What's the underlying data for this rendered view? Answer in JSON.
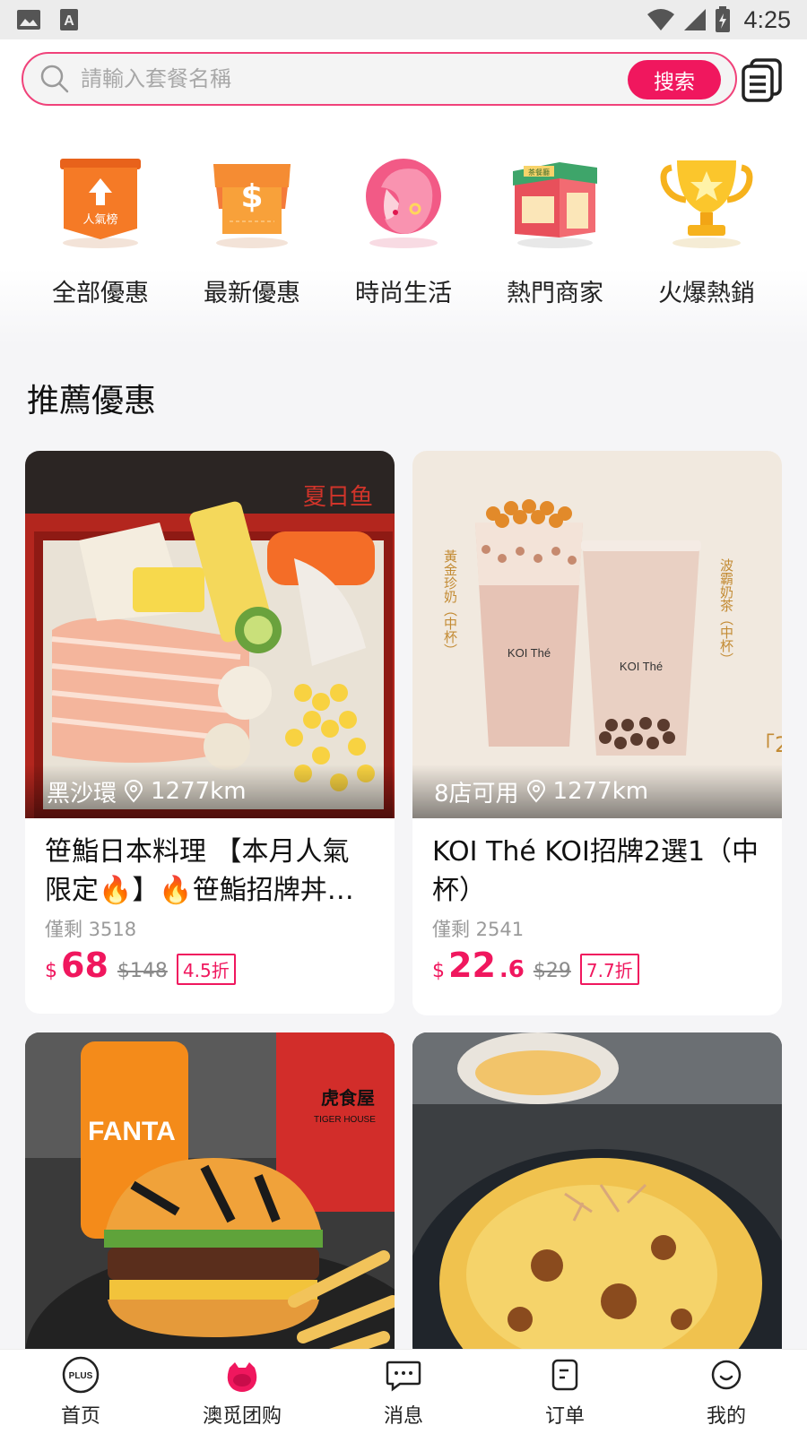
{
  "status_bar": {
    "time": "4:25",
    "icons": [
      "image-icon",
      "text-a-icon",
      "wifi-icon",
      "signal-icon",
      "battery-icon"
    ]
  },
  "search": {
    "placeholder": "請輸入套餐名稱",
    "button_label": "搜索"
  },
  "categories": [
    {
      "label": "全部優惠",
      "icon": "popularity-ranking-icon",
      "badge": "人氣榜"
    },
    {
      "label": "最新優惠",
      "icon": "coupon-dollar-icon"
    },
    {
      "label": "時尚生活",
      "icon": "fashion-woman-icon"
    },
    {
      "label": "熱門商家",
      "icon": "shop-icon",
      "badge": "茶餐廳"
    },
    {
      "label": "火爆熱銷",
      "icon": "trophy-icon"
    }
  ],
  "section": {
    "title": "推薦優惠"
  },
  "products": [
    {
      "location": "黑沙環",
      "distance": "1277km",
      "title": "笹鮨日本料理 【本月人氣限定🔥】🔥笹鮨招牌丼…",
      "remaining": "僅剩 3518",
      "currency": "$",
      "price_int": "68",
      "price_dec": "",
      "original_price": "$148",
      "discount": "4.5折",
      "image_text": "夏日鱼"
    },
    {
      "location": "8店可用",
      "distance": "1277km",
      "title": "KOI Thé KOI招牌2選1（中杯）",
      "remaining": "僅剩 2541",
      "currency": "$",
      "price_int": "22",
      "price_dec": ".6",
      "original_price": "$29",
      "discount": "7.7折",
      "image_text_left": "黃金珍奶（中杯）",
      "image_text_right": "波霸奶茶（中杯）",
      "cup_brand": "KOI Thé",
      "corner_text": "「2"
    },
    {
      "image": "tiger-burger-fries",
      "image_text": "FANTA",
      "box_text": "虎食屋",
      "box_sub": "TIGER HOUSE"
    },
    {
      "image": "okonomiyaki-plate"
    }
  ],
  "bottom_nav": [
    {
      "label": "首页",
      "icon": "plus-home-icon"
    },
    {
      "label": "澳觅团购",
      "icon": "group-buy-icon"
    },
    {
      "label": "消息",
      "icon": "message-icon"
    },
    {
      "label": "订单",
      "icon": "order-icon"
    },
    {
      "label": "我的",
      "icon": "profile-icon"
    }
  ],
  "colors": {
    "accent": "#f0175e",
    "background": "#f5f5f7"
  }
}
